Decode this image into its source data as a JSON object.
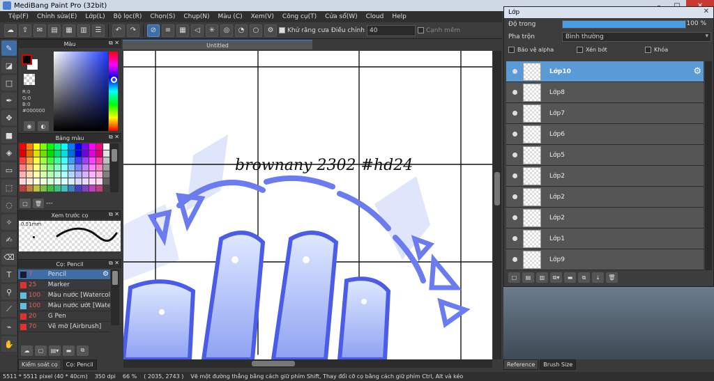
{
  "window": {
    "title": "MediBang Paint Pro (32bit)",
    "buttons": [
      "–",
      "□",
      "✕"
    ]
  },
  "menu": [
    "Tệp(F)",
    "Chỉnh sửa(E)",
    "Lớp(L)",
    "Bộ lọc(R)",
    "Chọn(S)",
    "Chụp(N)",
    "Màu (C)",
    "Xem(V)",
    "Công cụ(T)",
    "Cửa sổ(W)",
    "Cloud",
    "Help"
  ],
  "toolbar": {
    "antialias_label": "Khử răng cưa",
    "correction_label": "Điều chỉnh",
    "correction_value": "40",
    "snap_label": "Cạnh mềm"
  },
  "colors": {
    "accent": "#3f6ea6",
    "selected_layer": "#5b9bd5",
    "opacity_bar": "#4a9fe0",
    "current_color": "#000000"
  },
  "color_panel": {
    "title": "Màu",
    "r": "R:0",
    "g": "G:0",
    "b": "B:0",
    "hex": "#000000"
  },
  "palette_panel": {
    "title": "Bảng màu",
    "footer_text": "---",
    "swatches": [
      "#ff0000",
      "#ff8000",
      "#ffff00",
      "#80ff00",
      "#00ff00",
      "#00ff80",
      "#00ffff",
      "#0080ff",
      "#0000ff",
      "#8000ff",
      "#ff00ff",
      "#ff0080",
      "#ffffff",
      "#e00000",
      "#e07000",
      "#e0e000",
      "#70e000",
      "#00e000",
      "#00e070",
      "#00e0e0",
      "#0070e0",
      "#0000e0",
      "#7000e0",
      "#e000e0",
      "#e00070",
      "#e0e0e0",
      "#ff4040",
      "#ffa040",
      "#ffff40",
      "#a0ff40",
      "#40ff40",
      "#40ffa0",
      "#40ffff",
      "#40a0ff",
      "#4040ff",
      "#a040ff",
      "#ff40ff",
      "#ff40a0",
      "#c0c0c0",
      "#ff8080",
      "#ffc080",
      "#ffff80",
      "#c0ff80",
      "#80ff80",
      "#80ffc0",
      "#80ffff",
      "#80c0ff",
      "#8080ff",
      "#c080ff",
      "#ff80ff",
      "#ff80c0",
      "#a0a0a0",
      "#ffb0b0",
      "#ffd8b0",
      "#ffffb0",
      "#d8ffb0",
      "#b0ffb0",
      "#b0ffd8",
      "#b0ffff",
      "#b0d8ff",
      "#b0b0ff",
      "#d8b0ff",
      "#ffb0ff",
      "#ffb0d8",
      "#808080",
      "#ffd8d8",
      "#ffecd8",
      "#ffffd8",
      "#ecffd8",
      "#d8ffd8",
      "#d8ffec",
      "#d8ffff",
      "#d8ecff",
      "#d8d8ff",
      "#ecd8ff",
      "#ffd8ff",
      "#ffd8ec",
      "#606060",
      "#c04040",
      "#c08040",
      "#c0c040",
      "#80c040",
      "#40c040",
      "#40c080",
      "#40c0c0",
      "#4080c0",
      "#4040c0",
      "#8040c0",
      "#c040c0",
      "#c04080",
      "#404040"
    ]
  },
  "brush_preview": {
    "title": "Xem trước cọ",
    "size": "0.51mm"
  },
  "brush_panel": {
    "title": "Cọ: Pencil",
    "brushes": [
      {
        "size": "7",
        "name": "Pencil",
        "color": "#1a1a2e",
        "selected": true
      },
      {
        "size": "25",
        "name": "Marker",
        "color": "#e03030",
        "selected": false
      },
      {
        "size": "100",
        "name": "Màu nước [Watercolo",
        "color": "#60c0e0",
        "selected": false
      },
      {
        "size": "100",
        "name": "Màu nước ướt [Wate",
        "color": "#60c0e0",
        "selected": false
      },
      {
        "size": "20",
        "name": "G Pen",
        "color": "#e03030",
        "selected": false
      },
      {
        "size": "70",
        "name": "Vẽ mờ [Airbrush]",
        "color": "#e03030",
        "selected": false
      }
    ]
  },
  "left_tabs": [
    "Kiểm soát cọ",
    "Cọ: Pencil"
  ],
  "canvas": {
    "tab_title": "Untitled",
    "signature_text": "brownany 2302 #hd24"
  },
  "status": {
    "dims": "5511 * 5511 pixel  (40 * 40cm)",
    "dpi": "350 dpi",
    "zoom": "66 %",
    "coords": "( 2035, 2743 )",
    "hint": "Vẽ một đường thẳng bằng cách giữ phím Shift, Thay đổi cỡ cọ bằng cách giữ phím Ctrl, Alt và kéo"
  },
  "layer_panel": {
    "title": "Lớp",
    "opacity_label": "Độ trong",
    "opacity_value": "100 %",
    "opacity": 1.0,
    "blend_label": "Pha trộn",
    "blend_value": "Bình thường",
    "protect_alpha": "Bảo vệ alpha",
    "clipping": "Xén bớt",
    "lock": "Khóa",
    "layers": [
      {
        "name": "Lớp10",
        "selected": true
      },
      {
        "name": "Lớp8",
        "selected": false
      },
      {
        "name": "Lớp7",
        "selected": false
      },
      {
        "name": "Lớp6",
        "selected": false
      },
      {
        "name": "Lớp5",
        "selected": false
      },
      {
        "name": "Lớp2",
        "selected": false
      },
      {
        "name": "Lớp2",
        "selected": false
      },
      {
        "name": "Lớp2",
        "selected": false
      },
      {
        "name": "Lớp1",
        "selected": false
      },
      {
        "name": "Lớp9",
        "selected": false
      }
    ]
  },
  "right_tabs": [
    "Reference",
    "Brush Size"
  ]
}
